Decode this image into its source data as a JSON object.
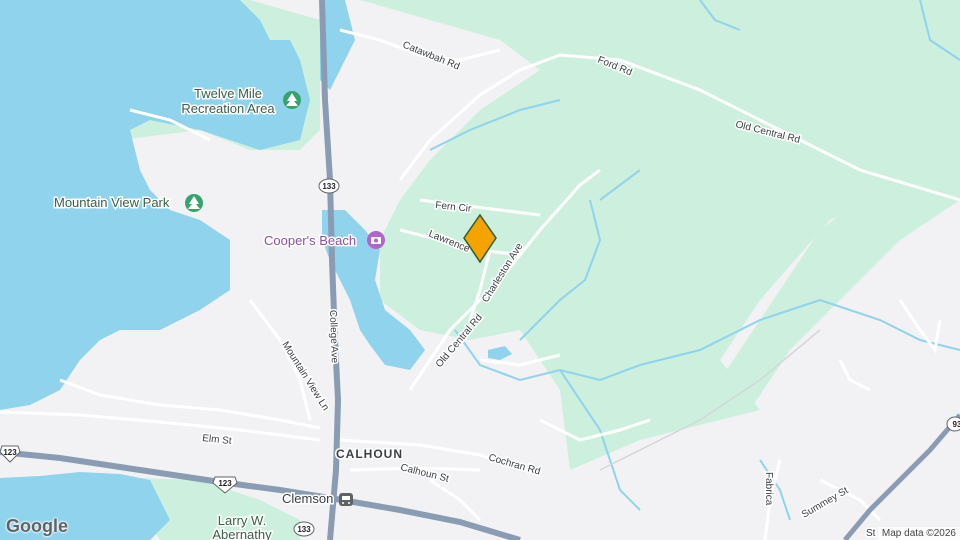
{
  "map": {
    "parks": [
      {
        "label_lines": [
          "Twelve Mile",
          "Recreation Area"
        ]
      },
      {
        "label_lines": [
          "Mountain View Park"
        ]
      },
      {
        "label_lines": [
          "Larry W.",
          "Abernathy"
        ]
      }
    ],
    "poi": {
      "label": "Cooper's Beach"
    },
    "town": "CALHOUN",
    "station": "Clemson",
    "roads": {
      "catawbah": "Catawbah Rd",
      "ford": "Ford Rd",
      "old_central_top": "Old Central Rd",
      "old_central_mid": "Old Central Rd",
      "fern": "Fern Cir",
      "lawrence": "Lawrence",
      "charleston": "Charleston Ave",
      "college": "College Ave",
      "mountain_view_ln": "Mountain View Ln",
      "elm": "Elm St",
      "calhoun": "Calhoun St",
      "cochran": "Cochran Rd",
      "fabrica": "Fabrica",
      "summey": "Summey St",
      "st_fragment": "St"
    },
    "shields": {
      "route_133_a": "133",
      "route_133_b": "133",
      "us_123_a": "123",
      "us_123_b": "123",
      "route_93": "93"
    },
    "attribution": "Map data ©2026",
    "logo": "Google",
    "colors": {
      "water": "#8fd3ec",
      "park": "#ccf0dd",
      "land": "#f2f2f4",
      "highway": "#8a9cb3",
      "marker": "#f4a300"
    }
  }
}
